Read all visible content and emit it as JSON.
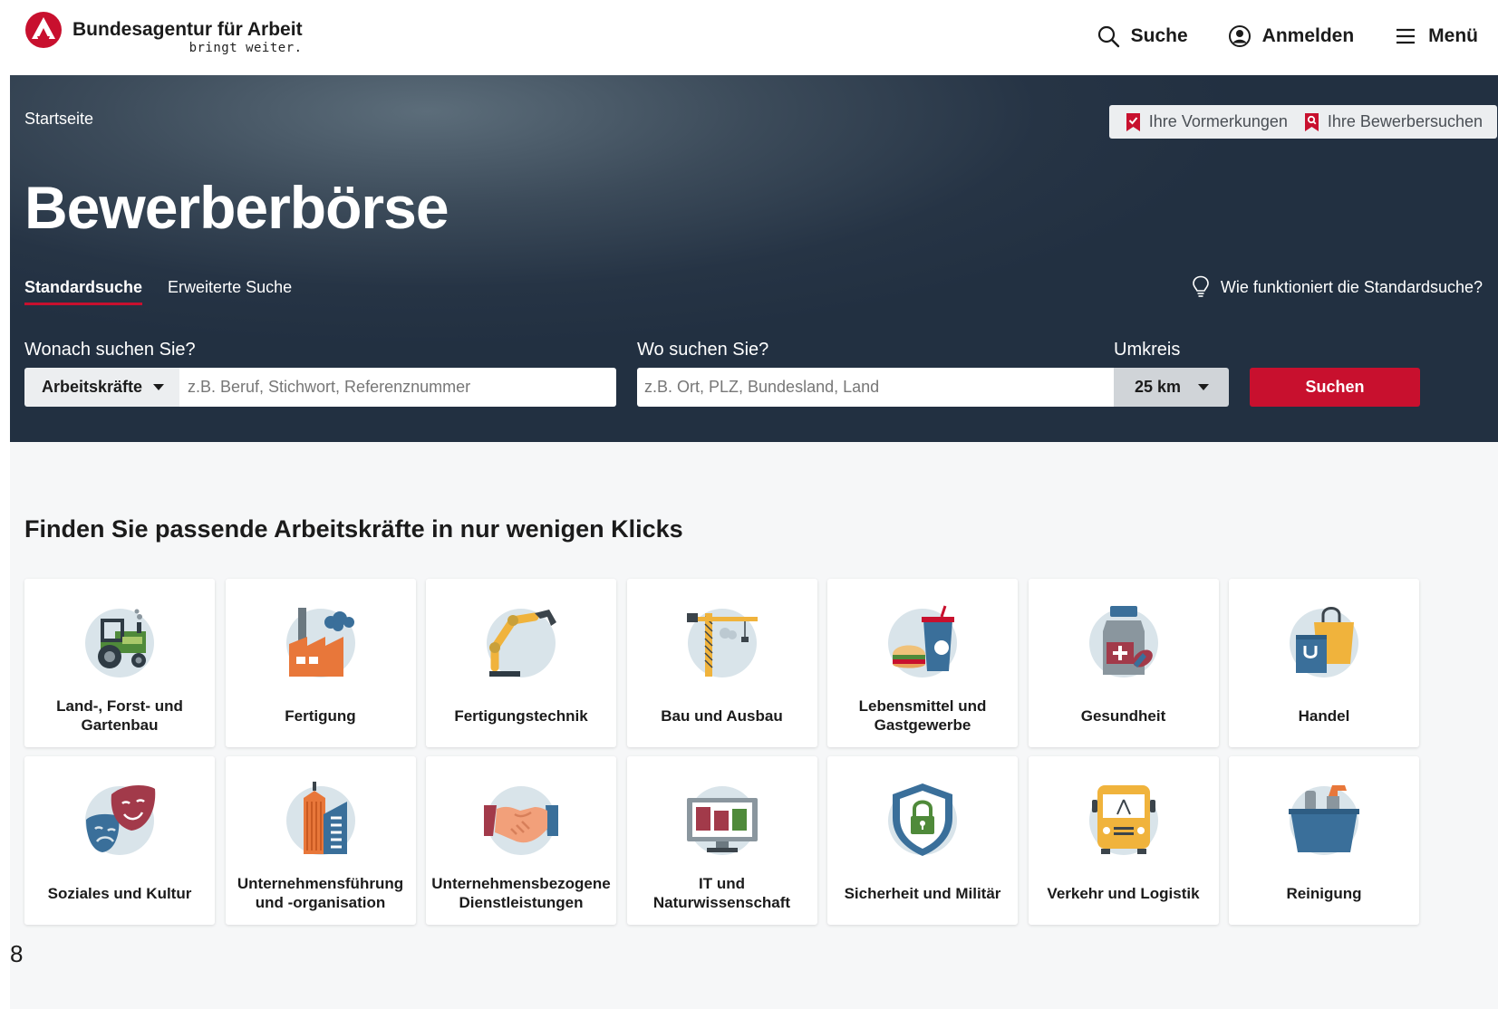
{
  "header": {
    "brand_name": "Bundesagentur für Arbeit",
    "brand_slogan": "bringt weiter.",
    "nav": {
      "search": "Suche",
      "login": "Anmelden",
      "menu": "Menü"
    }
  },
  "hero": {
    "breadcrumb": "Startseite",
    "saved": {
      "bookmarks": "Ihre Vormerkungen",
      "searches": "Ihre Bewerbersuchen"
    },
    "title": "Bewerberbörse",
    "tabs": [
      {
        "label": "Standardsuche",
        "active": true
      },
      {
        "label": "Erweiterte Suche",
        "active": false
      }
    ],
    "howto": "Wie funktioniert die Standardsuche?",
    "search": {
      "what_label": "Wonach suchen Sie?",
      "type_value": "Arbeitskräfte",
      "what_placeholder": "z.B. Beruf, Stichwort, Referenznummer",
      "where_label": "Wo suchen Sie?",
      "where_placeholder": "z.B. Ort, PLZ, Bundesland, Land",
      "radius_label": "Umkreis",
      "radius_value": "25 km",
      "submit": "Suchen"
    }
  },
  "categories": {
    "title": "Finden Sie passende Arbeitskräfte in nur wenigen Klicks",
    "items": [
      {
        "label": "Land-, Forst- und Gartenbau",
        "icon": "tractor-icon"
      },
      {
        "label": "Fertigung",
        "icon": "factory-icon"
      },
      {
        "label": "Fertigungstechnik",
        "icon": "robot-arm-icon"
      },
      {
        "label": "Bau und Ausbau",
        "icon": "crane-icon"
      },
      {
        "label": "Lebensmittel und Gastgewerbe",
        "icon": "burger-drink-icon"
      },
      {
        "label": "Gesundheit",
        "icon": "medicine-jar-icon"
      },
      {
        "label": "Handel",
        "icon": "shopping-bag-icon"
      },
      {
        "label": "Soziales und Kultur",
        "icon": "theater-masks-icon"
      },
      {
        "label": "Unternehmensführung und -organisation",
        "icon": "office-building-icon"
      },
      {
        "label": "Unternehmensbezogene Dienstleistungen",
        "icon": "handshake-icon"
      },
      {
        "label": "IT und Naturwissenschaft",
        "icon": "monitor-chart-icon"
      },
      {
        "label": "Sicherheit und Militär",
        "icon": "shield-lock-icon"
      },
      {
        "label": "Verkehr und Logistik",
        "icon": "bus-icon"
      },
      {
        "label": "Reinigung",
        "icon": "cleaning-bucket-icon"
      }
    ]
  },
  "page_number": "8",
  "colors": {
    "accent": "#c8102e",
    "hero": "#263445",
    "page_bg": "#f6f7f8",
    "icon_circle": "#d9e4ea"
  }
}
